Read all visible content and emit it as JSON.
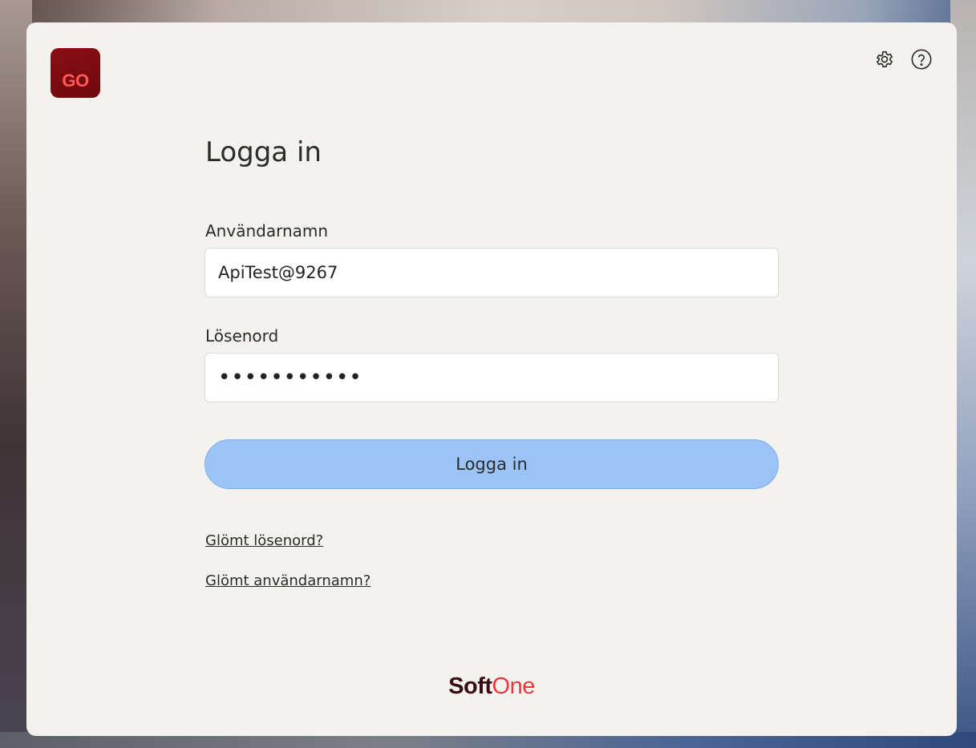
{
  "app": {
    "logo_text": "GO",
    "brand_part1": "Soft",
    "brand_part2": "One",
    "brand_colors": {
      "logo_bg": "#7a0b11",
      "logo_text": "#ff5a55",
      "brand_dark": "#3a0c12",
      "brand_red": "#e8383d"
    }
  },
  "toolbar": {
    "settings_icon": "gear-icon",
    "help_icon": "question-circle-icon"
  },
  "login": {
    "title": "Logga in",
    "username_label": "Användarnamn",
    "username_value": "ApiTest@9267",
    "password_label": "Lösenord",
    "password_value": "•••••••••••",
    "submit_label": "Logga in",
    "forgot_password": "Glömt lösenord?",
    "forgot_username": "Glömt användarnamn?",
    "button_color": "#9bc3f5"
  }
}
